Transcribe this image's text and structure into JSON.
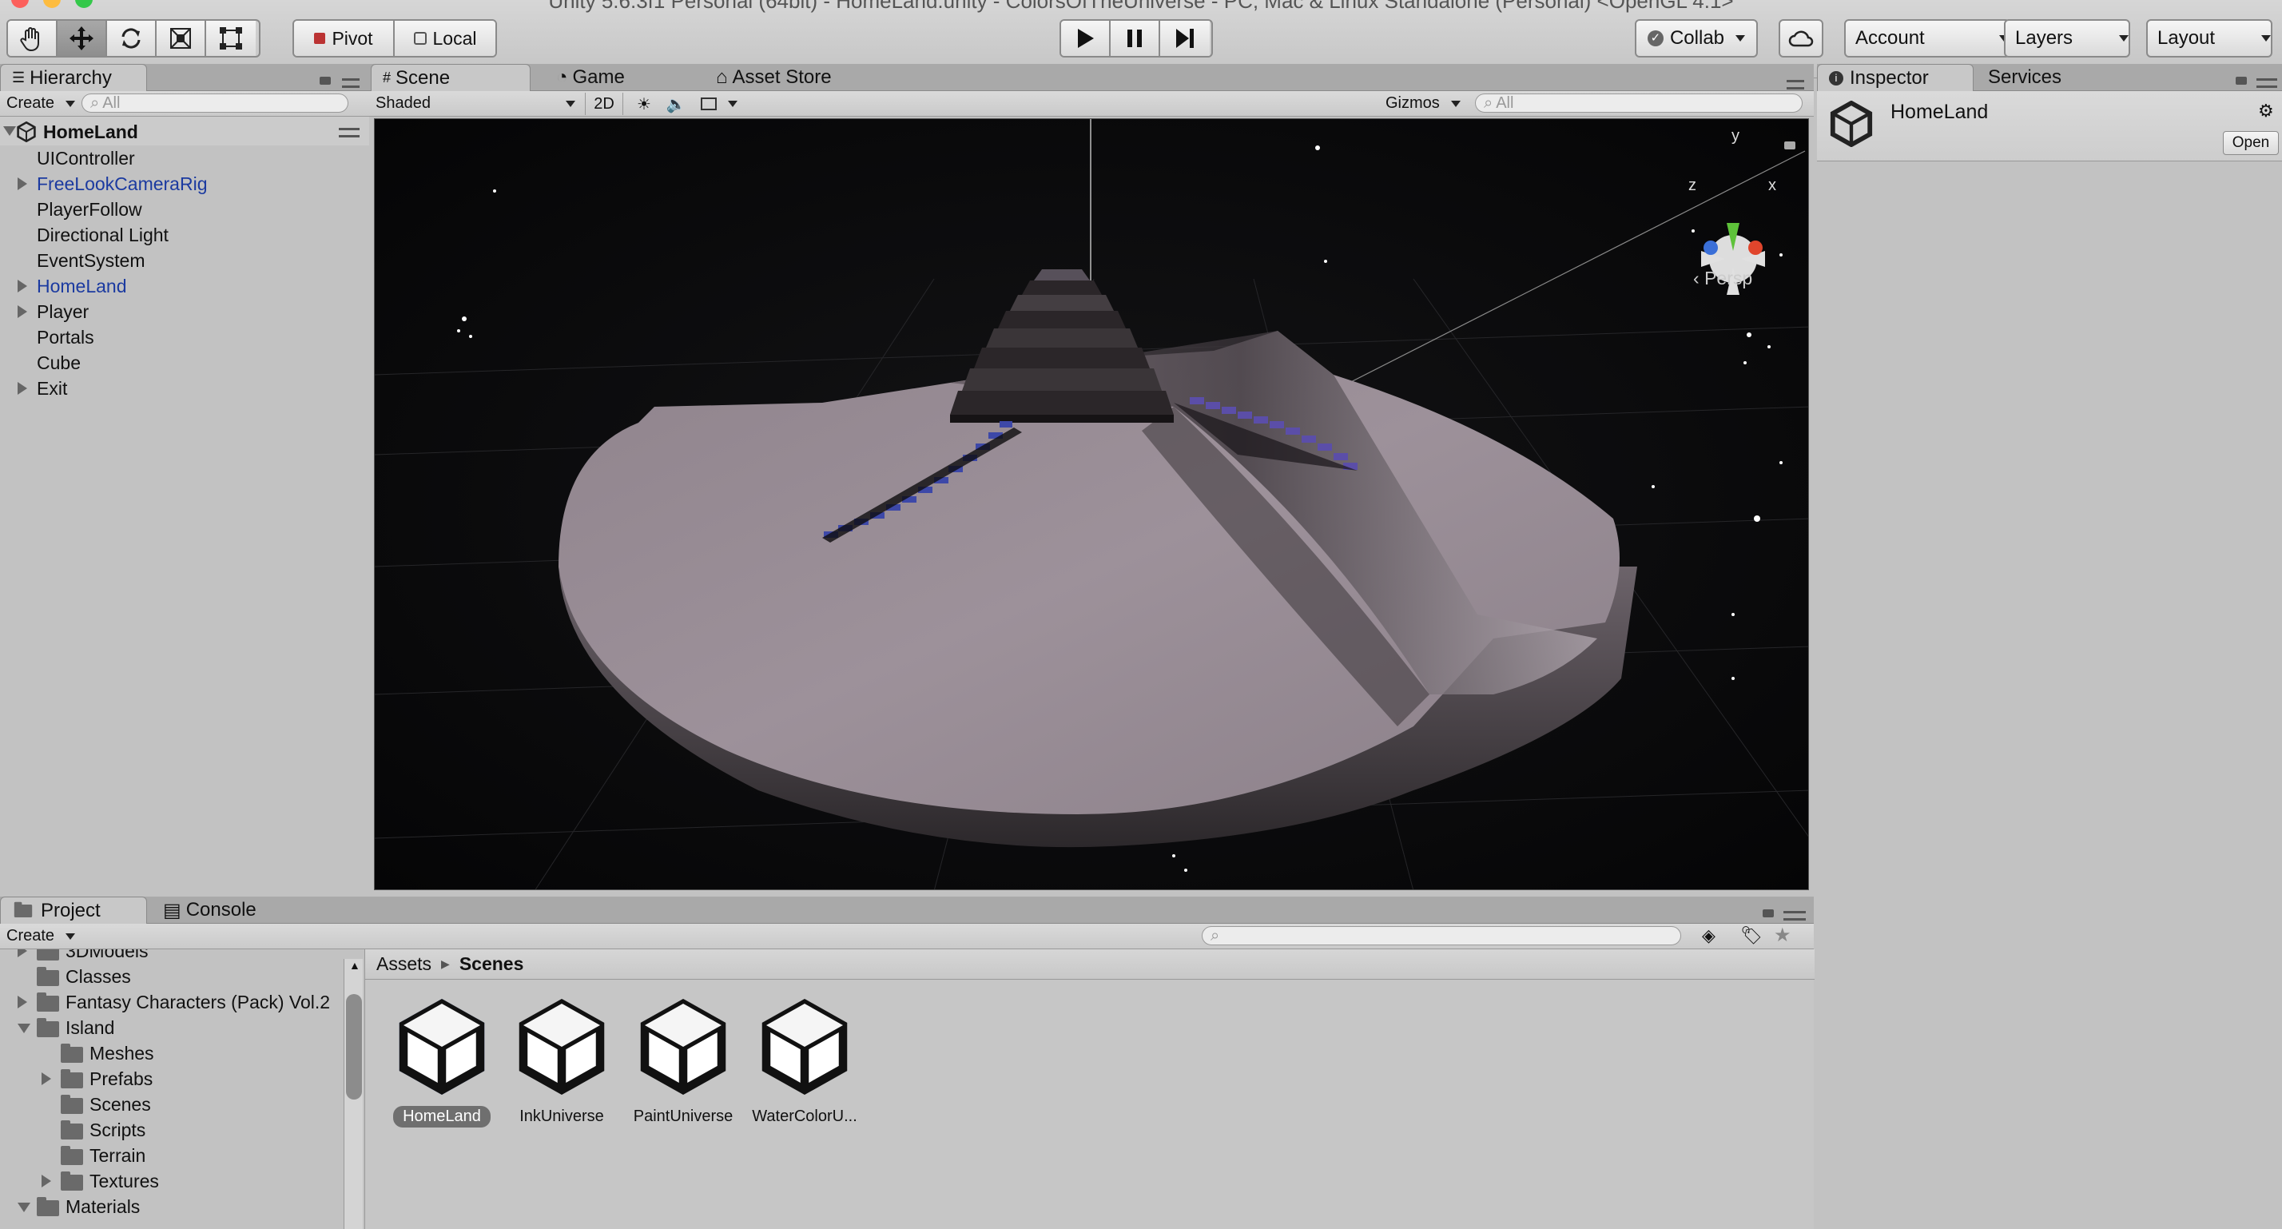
{
  "window": {
    "title": "Unity 5.6.3f1 Personal (64bit) - HomeLand.unity - ColorsOfTheUniverse - PC, Mac & Linux Standalone (Personal) <OpenGL 4.1>"
  },
  "toolbar": {
    "tools": [
      "hand-icon",
      "move-icon",
      "rotate-icon",
      "scale-icon",
      "rect-icon"
    ],
    "pivot_label": "Pivot",
    "local_label": "Local",
    "collab_label": "Collab",
    "account_label": "Account",
    "layers_label": "Layers",
    "layout_label": "Layout"
  },
  "hierarchy": {
    "tab_label": "Hierarchy",
    "create_label": "Create",
    "search_placeholder": "All",
    "scene_name": "HomeLand",
    "items": [
      {
        "label": "UIController",
        "expandable": false,
        "prefab": false
      },
      {
        "label": "FreeLookCameraRig",
        "expandable": true,
        "prefab": true
      },
      {
        "label": "PlayerFollow",
        "expandable": false,
        "prefab": false
      },
      {
        "label": "Directional Light",
        "expandable": false,
        "prefab": false
      },
      {
        "label": "EventSystem",
        "expandable": false,
        "prefab": false
      },
      {
        "label": "HomeLand",
        "expandable": true,
        "prefab": true
      },
      {
        "label": "Player",
        "expandable": true,
        "prefab": false
      },
      {
        "label": "Portals",
        "expandable": false,
        "prefab": false
      },
      {
        "label": "Cube",
        "expandable": false,
        "prefab": false
      },
      {
        "label": "Exit",
        "expandable": true,
        "prefab": false
      }
    ]
  },
  "scene": {
    "tabs": [
      "Scene",
      "Game",
      "Asset Store"
    ],
    "shading_mode": "Shaded",
    "mode_2d_label": "2D",
    "gizmos_label": "Gizmos",
    "search_placeholder": "All",
    "gizmo_axes": {
      "y": "y",
      "x": "x",
      "z": "z"
    },
    "projection_label": "Persp"
  },
  "inspector": {
    "tabs": [
      "Inspector",
      "Services"
    ],
    "object_name": "HomeLand",
    "open_label": "Open"
  },
  "project": {
    "tabs": [
      "Project",
      "Console"
    ],
    "create_label": "Create",
    "breadcrumb": {
      "root": "Assets",
      "current": "Scenes"
    },
    "tree": [
      {
        "label": "3DModels",
        "indent": 1,
        "arrow": "right"
      },
      {
        "label": "Classes",
        "indent": 1,
        "arrow": "none"
      },
      {
        "label": "Fantasy Characters (Pack) Vol.2",
        "indent": 1,
        "arrow": "right"
      },
      {
        "label": "Island",
        "indent": 1,
        "arrow": "down"
      },
      {
        "label": "Meshes",
        "indent": 2,
        "arrow": "none"
      },
      {
        "label": "Prefabs",
        "indent": 2,
        "arrow": "right"
      },
      {
        "label": "Scenes",
        "indent": 2,
        "arrow": "none"
      },
      {
        "label": "Scripts",
        "indent": 2,
        "arrow": "none"
      },
      {
        "label": "Terrain",
        "indent": 2,
        "arrow": "none"
      },
      {
        "label": "Textures",
        "indent": 2,
        "arrow": "right"
      },
      {
        "label": "Materials",
        "indent": 1,
        "arrow": "down"
      }
    ],
    "assets": [
      {
        "label": "HomeLand",
        "selected": true
      },
      {
        "label": "InkUniverse",
        "selected": false
      },
      {
        "label": "PaintUniverse",
        "selected": false
      },
      {
        "label": "WaterColorU...",
        "selected": false
      }
    ]
  },
  "colors": {
    "accent_blue": "#1b3aa0",
    "scene_bg": "#0b0b0d",
    "terrain": "#8f838c",
    "stairs_blue": "#3d48a8"
  }
}
